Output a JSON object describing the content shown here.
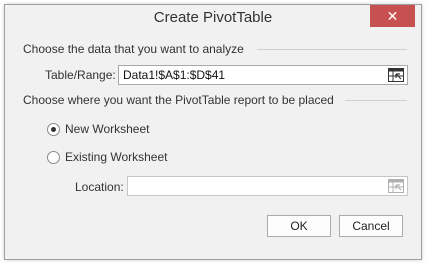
{
  "dialog": {
    "title": "Create PivotTable",
    "close_label": "✕",
    "analyze_section": "Choose the data that you want to analyze",
    "table_range_label": "Table/Range:",
    "table_range_value": "Data1!$A$1:$D$41",
    "placement_section": "Choose where you want the PivotTable report to be placed",
    "options": [
      {
        "label": "New Worksheet",
        "selected": true
      },
      {
        "label": "Existing Worksheet",
        "selected": false
      }
    ],
    "location_label": "Location:",
    "location_value": "",
    "ok_label": "OK",
    "cancel_label": "Cancel"
  },
  "colors": {
    "close_button": "#c75050",
    "dialog_background": "#f1f1f1"
  },
  "icons": {
    "range_picker": "range-selector-icon"
  }
}
